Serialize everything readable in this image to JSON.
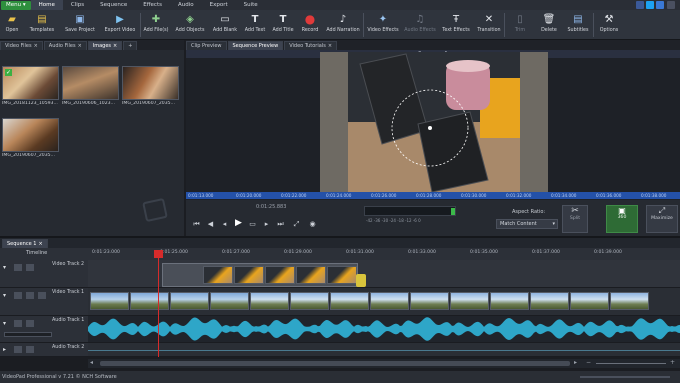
{
  "menubar": {
    "menu_label": "Menu",
    "tabs": [
      "Home",
      "Clips",
      "Sequence",
      "Effects",
      "Audio",
      "Export",
      "Suite"
    ]
  },
  "toolbar": {
    "items": [
      {
        "label": "Open",
        "icon": "folder-open-icon"
      },
      {
        "label": "Templates",
        "icon": "templates-icon"
      },
      {
        "label": "Save Project",
        "icon": "save-icon"
      },
      {
        "label": "Export Video",
        "icon": "export-video-icon"
      },
      {
        "label": "Add File(s)",
        "icon": "add-file-icon"
      },
      {
        "label": "Add Objects",
        "icon": "add-objects-icon"
      },
      {
        "label": "Add Blank",
        "icon": "add-blank-icon"
      },
      {
        "label": "Add Text",
        "icon": "add-text-icon"
      },
      {
        "label": "Add Title",
        "icon": "add-title-icon"
      },
      {
        "label": "Record",
        "icon": "record-icon"
      },
      {
        "label": "Add Narration",
        "icon": "microphone-icon"
      },
      {
        "label": "Video Effects",
        "icon": "video-effects-icon"
      },
      {
        "label": "Audio Effects",
        "icon": "audio-effects-icon"
      },
      {
        "label": "Text Effects",
        "icon": "text-effects-icon"
      },
      {
        "label": "Transition",
        "icon": "transition-icon"
      },
      {
        "label": "Trim",
        "icon": "trim-icon"
      },
      {
        "label": "Delete",
        "icon": "delete-icon"
      },
      {
        "label": "Subtitles",
        "icon": "subtitles-icon"
      },
      {
        "label": "Options",
        "icon": "options-icon"
      }
    ]
  },
  "bins": {
    "tabs": [
      "Video Files",
      "Audio Files",
      "Images"
    ],
    "clips": [
      "IMG_20181123_10593...",
      "IMG_20190606_1023...",
      "IMG_20190607_2035...",
      "IMG_20190607_2035..."
    ]
  },
  "preview": {
    "tabs": [
      "Clip Preview",
      "Sequence Preview",
      "Video Tutorials"
    ],
    "sequence_title": "Sequence 1",
    "ruler_ticks": [
      "0:01:13.000",
      "0:01:20.000",
      "0:01:22.000",
      "0:01:24.000",
      "0:01:26.000",
      "0:01:28.000",
      "0:01:30.000",
      "0:01:32.000",
      "0:01:34.000",
      "0:01:36.000",
      "0:01:38.000"
    ],
    "timecode": "0:01:25.883",
    "meter_scale": "-42 -36 -30 -24 -18 -12 -6 0",
    "aspect_ratio_label": "Aspect Ratio:",
    "aspect_ratio_value": "Match Content",
    "split_label": "Split",
    "split_360_label": "360",
    "maximize_label": "Maximize"
  },
  "timeline": {
    "sequence_tab": "Sequence 1",
    "timeline_label": "Timeline",
    "ruler_ticks": [
      "0:01:23.000",
      "0:01:25.000",
      "0:01:27.000",
      "0:01:29.000",
      "0:01:31.000",
      "0:01:33.000",
      "0:01:35.000",
      "0:01:37.000",
      "0:01:39.000"
    ],
    "tracks": [
      "Video Track 2",
      "Video Track 1",
      "Audio Track 1",
      "Audio Track 2"
    ]
  },
  "status": {
    "text": "VideoPad Professional v 7.21 © NCH Software"
  },
  "colors": {
    "accent_green": "#2e8f3d",
    "ruler_blue": "#2451a8",
    "waveform": "#2ea6c8",
    "playhead": "#d62b2b"
  }
}
